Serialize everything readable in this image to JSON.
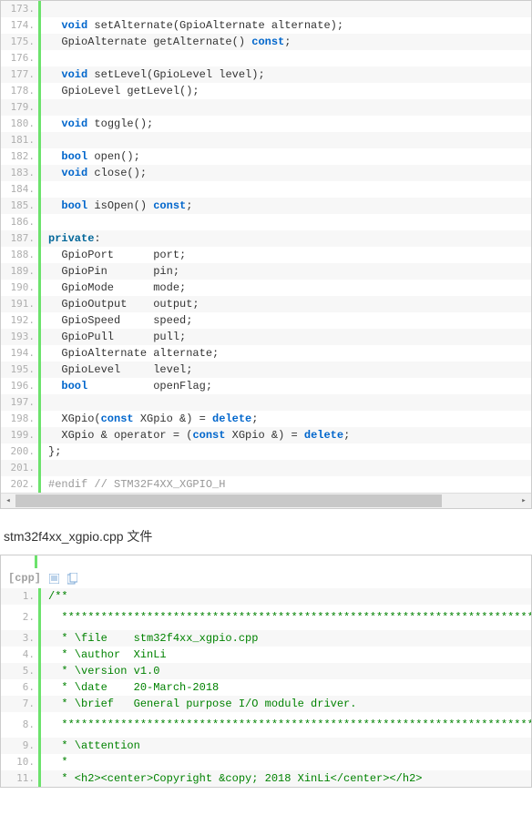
{
  "block1": {
    "lines": [
      {
        "n": "173.",
        "frags": [
          {
            "t": "  ",
            "c": ""
          }
        ]
      },
      {
        "n": "174.",
        "frags": [
          {
            "t": "  ",
            "c": ""
          },
          {
            "t": "void",
            "c": "kw"
          },
          {
            "t": " setAlternate(GpioAlternate alternate);",
            "c": ""
          }
        ]
      },
      {
        "n": "175.",
        "frags": [
          {
            "t": "  GpioAlternate getAlternate() ",
            "c": ""
          },
          {
            "t": "const",
            "c": "kw"
          },
          {
            "t": ";",
            "c": ""
          }
        ]
      },
      {
        "n": "176.",
        "frags": [
          {
            "t": "  ",
            "c": ""
          }
        ]
      },
      {
        "n": "177.",
        "frags": [
          {
            "t": "  ",
            "c": ""
          },
          {
            "t": "void",
            "c": "kw"
          },
          {
            "t": " setLevel(GpioLevel level);",
            "c": ""
          }
        ]
      },
      {
        "n": "178.",
        "frags": [
          {
            "t": "  GpioLevel getLevel();",
            "c": ""
          }
        ]
      },
      {
        "n": "179.",
        "frags": [
          {
            "t": "  ",
            "c": ""
          }
        ]
      },
      {
        "n": "180.",
        "frags": [
          {
            "t": "  ",
            "c": ""
          },
          {
            "t": "void",
            "c": "kw"
          },
          {
            "t": " toggle();",
            "c": ""
          }
        ]
      },
      {
        "n": "181.",
        "frags": [
          {
            "t": "  ",
            "c": ""
          }
        ]
      },
      {
        "n": "182.",
        "frags": [
          {
            "t": "  ",
            "c": ""
          },
          {
            "t": "bool",
            "c": "kw"
          },
          {
            "t": " open();",
            "c": ""
          }
        ]
      },
      {
        "n": "183.",
        "frags": [
          {
            "t": "  ",
            "c": ""
          },
          {
            "t": "void",
            "c": "kw"
          },
          {
            "t": " close();",
            "c": ""
          }
        ]
      },
      {
        "n": "184.",
        "frags": [
          {
            "t": "  ",
            "c": ""
          }
        ]
      },
      {
        "n": "185.",
        "frags": [
          {
            "t": "  ",
            "c": ""
          },
          {
            "t": "bool",
            "c": "kw"
          },
          {
            "t": " isOpen() ",
            "c": ""
          },
          {
            "t": "const",
            "c": "kw"
          },
          {
            "t": ";",
            "c": ""
          }
        ]
      },
      {
        "n": "186.",
        "frags": [
          {
            "t": "  ",
            "c": ""
          }
        ]
      },
      {
        "n": "187.",
        "frags": [
          {
            "t": "",
            "c": ""
          },
          {
            "t": "private",
            "c": "kw2"
          },
          {
            "t": ":",
            "c": ""
          }
        ]
      },
      {
        "n": "188.",
        "frags": [
          {
            "t": "  GpioPort      port;",
            "c": ""
          }
        ]
      },
      {
        "n": "189.",
        "frags": [
          {
            "t": "  GpioPin       pin;",
            "c": ""
          }
        ]
      },
      {
        "n": "190.",
        "frags": [
          {
            "t": "  GpioMode      mode;",
            "c": ""
          }
        ]
      },
      {
        "n": "191.",
        "frags": [
          {
            "t": "  GpioOutput    output;",
            "c": ""
          }
        ]
      },
      {
        "n": "192.",
        "frags": [
          {
            "t": "  GpioSpeed     speed;",
            "c": ""
          }
        ]
      },
      {
        "n": "193.",
        "frags": [
          {
            "t": "  GpioPull      pull;",
            "c": ""
          }
        ]
      },
      {
        "n": "194.",
        "frags": [
          {
            "t": "  GpioAlternate alternate;",
            "c": ""
          }
        ]
      },
      {
        "n": "195.",
        "frags": [
          {
            "t": "  GpioLevel     level;",
            "c": ""
          }
        ]
      },
      {
        "n": "196.",
        "frags": [
          {
            "t": "  ",
            "c": ""
          },
          {
            "t": "bool",
            "c": "kw"
          },
          {
            "t": "          openFlag;",
            "c": ""
          }
        ]
      },
      {
        "n": "197.",
        "frags": [
          {
            "t": "  ",
            "c": ""
          }
        ]
      },
      {
        "n": "198.",
        "frags": [
          {
            "t": "  XGpio(",
            "c": ""
          },
          {
            "t": "const",
            "c": "kw"
          },
          {
            "t": " XGpio &) = ",
            "c": ""
          },
          {
            "t": "delete",
            "c": "kw"
          },
          {
            "t": ";",
            "c": ""
          }
        ]
      },
      {
        "n": "199.",
        "frags": [
          {
            "t": "  XGpio & operator = (",
            "c": ""
          },
          {
            "t": "const",
            "c": "kw"
          },
          {
            "t": " XGpio &) = ",
            "c": ""
          },
          {
            "t": "delete",
            "c": "kw"
          },
          {
            "t": ";",
            "c": ""
          }
        ]
      },
      {
        "n": "200.",
        "frags": [
          {
            "t": "};",
            "c": ""
          }
        ]
      },
      {
        "n": "201.",
        "frags": [
          {
            "t": "  ",
            "c": ""
          }
        ]
      },
      {
        "n": "202.",
        "frags": [
          {
            "t": "#endif // STM32F4XX_XGPIO_H",
            "c": "preproc"
          }
        ]
      }
    ]
  },
  "section_title": "stm32f4xx_xgpio.cpp 文件",
  "block2": {
    "header_label": "[cpp]",
    "lines": [
      {
        "n": "1.",
        "frags": [
          {
            "t": "/**",
            "c": "cmt"
          }
        ]
      },
      {
        "n": "2.",
        "frags": [
          {
            "t": "  ******************************************************************************",
            "c": "cmt"
          }
        ]
      },
      {
        "n": "3.",
        "frags": [
          {
            "t": "  * \\file    stm32f4xx_xgpio.cpp",
            "c": "cmt"
          }
        ]
      },
      {
        "n": "4.",
        "frags": [
          {
            "t": "  * \\author  XinLi",
            "c": "cmt"
          }
        ]
      },
      {
        "n": "5.",
        "frags": [
          {
            "t": "  * \\version v1.0",
            "c": "cmt"
          }
        ]
      },
      {
        "n": "6.",
        "frags": [
          {
            "t": "  * \\date    20-March-2018",
            "c": "cmt"
          }
        ]
      },
      {
        "n": "7.",
        "frags": [
          {
            "t": "  * \\brief   General purpose I/O module driver.",
            "c": "cmt"
          }
        ]
      },
      {
        "n": "8.",
        "frags": [
          {
            "t": "  ******************************************************************************",
            "c": "cmt"
          }
        ]
      },
      {
        "n": "9.",
        "frags": [
          {
            "t": "  * \\attention",
            "c": "cmt"
          }
        ]
      },
      {
        "n": "10.",
        "frags": [
          {
            "t": "  *",
            "c": "cmt"
          }
        ]
      },
      {
        "n": "11.",
        "frags": [
          {
            "t": "  * <h2><center>Copyright &copy; 2018 XinLi</center></h2>",
            "c": "cmt"
          }
        ]
      }
    ]
  }
}
